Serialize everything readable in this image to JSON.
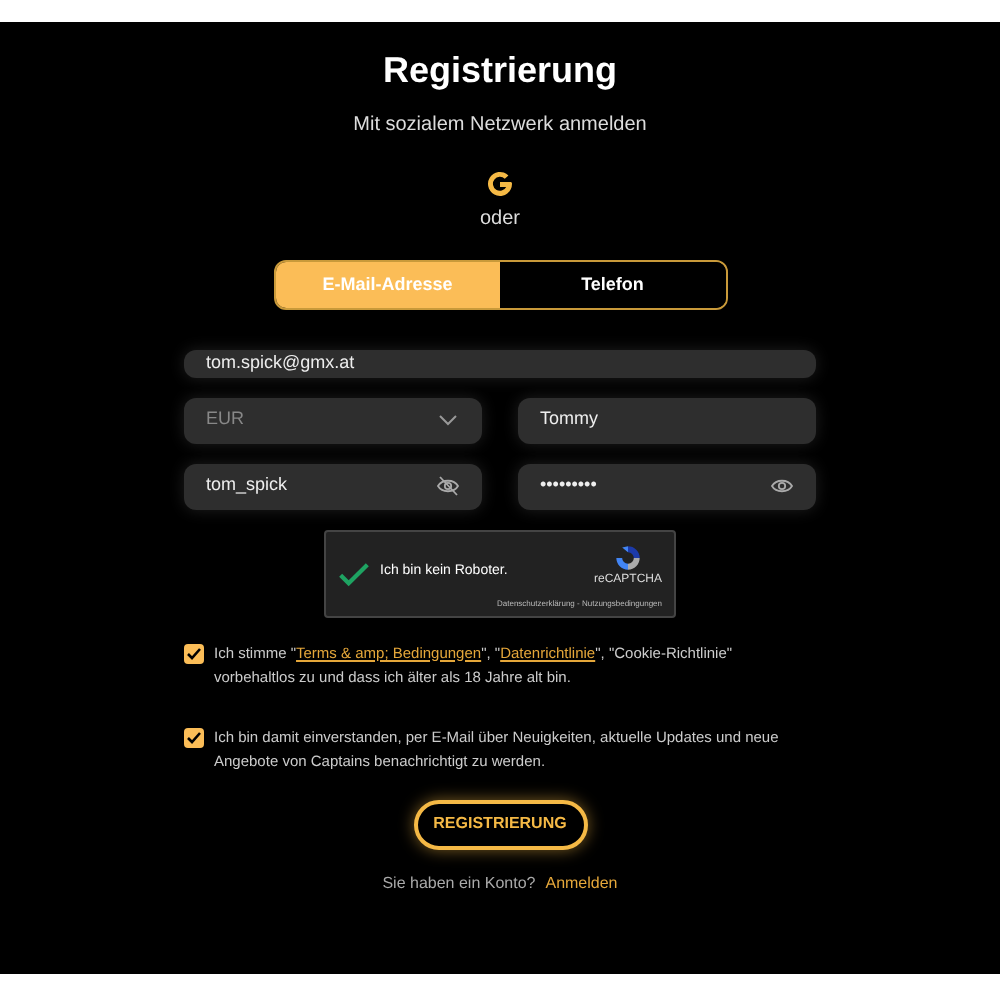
{
  "title": "Registrierung",
  "social_label": "Mit sozialem Netzwerk anmelden",
  "divider_text": "oder",
  "tabs": [
    {
      "label": "E-Mail-Adresse",
      "selected": true
    },
    {
      "label": "Telefon",
      "selected": false
    }
  ],
  "email": {
    "value": "tom.spick@gmx.at"
  },
  "currency": {
    "value": "EUR"
  },
  "first_name": {
    "value": "Tommy"
  },
  "username": {
    "value": "tom_spick"
  },
  "password": {
    "value": "•••••••••"
  },
  "captcha": {
    "checked": true,
    "label": "Ich bin kein Roboter.",
    "brand": "reCAPTCHA",
    "links": "Datenschutzerklärung - Nutzungsbedingungen"
  },
  "consents": [
    {
      "checked": true,
      "parts": [
        {
          "kind": "text",
          "text": "Ich stimme \""
        },
        {
          "kind": "link",
          "text": "Terms & amp; Bedingungen"
        },
        {
          "kind": "text",
          "text": "\", \""
        },
        {
          "kind": "link",
          "text": "Datenrichtlinie"
        },
        {
          "kind": "text",
          "text": "\", \"Cookie-Richtlinie\" vorbehaltlos zu und dass ich älter als 18 Jahre alt bin."
        }
      ]
    },
    {
      "checked": true,
      "parts": [
        {
          "kind": "text",
          "text": "Ich bin damit einverstanden, per E-Mail über Neuigkeiten, aktuelle Updates und neue Angebote von Captains benachrichtigt zu werden."
        }
      ]
    }
  ],
  "submit": "REGISTRIERUNG",
  "login_prompt": "Sie haben ein Konto?",
  "login_link": "Anmelden"
}
